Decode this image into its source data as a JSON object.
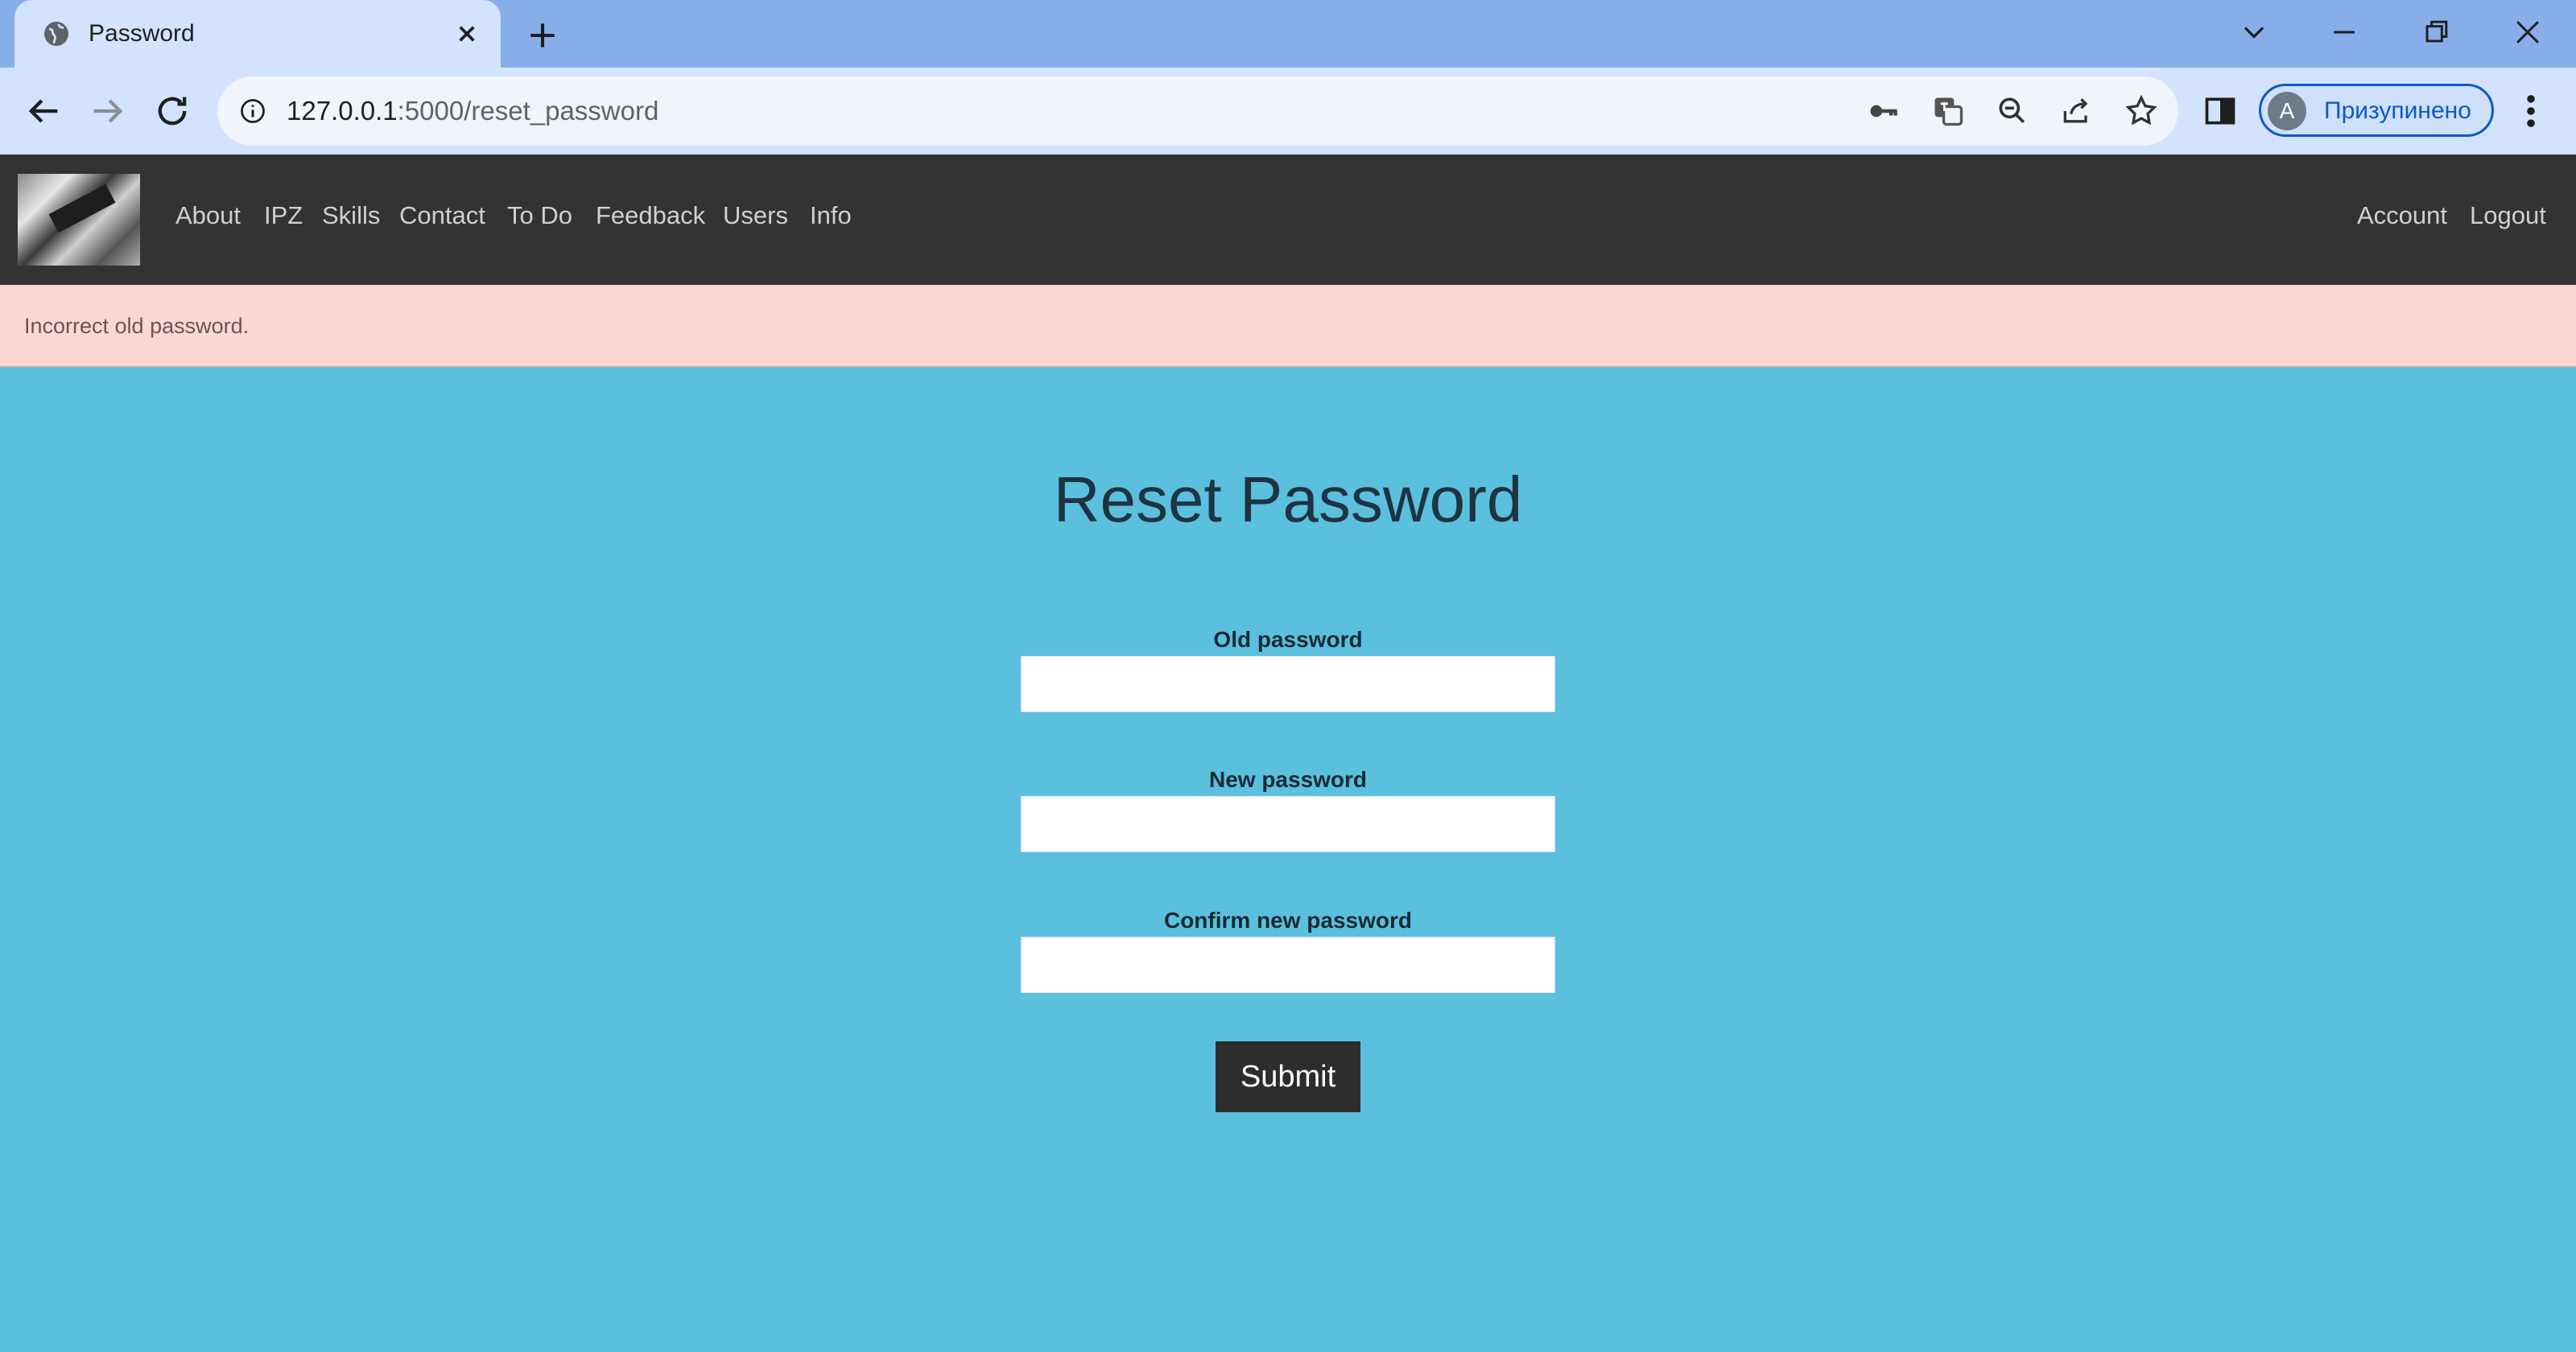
{
  "browser": {
    "tab_title": "Password",
    "url_host": "127.0.0.1",
    "url_rest": ":5000/reset_password",
    "profile_initial": "A",
    "profile_label": "Призупинено"
  },
  "nav": {
    "links": [
      "About",
      "IPZ",
      "Skills",
      "Contact",
      "To Do",
      "Feedback",
      "Users",
      "Info"
    ],
    "right_links": [
      "Account",
      "Logout"
    ]
  },
  "alert": {
    "message": "Incorrect old password."
  },
  "form": {
    "title": "Reset Password",
    "old_password_label": "Old password",
    "new_password_label": "New password",
    "confirm_password_label": "Confirm new password",
    "old_password_value": "",
    "new_password_value": "",
    "confirm_password_value": "",
    "submit_label": "Submit"
  },
  "colors": {
    "page_background": "#5bbfde",
    "nav_background": "#333333",
    "alert_background": "#fdd8d3",
    "button_background": "#2d2d2d"
  }
}
